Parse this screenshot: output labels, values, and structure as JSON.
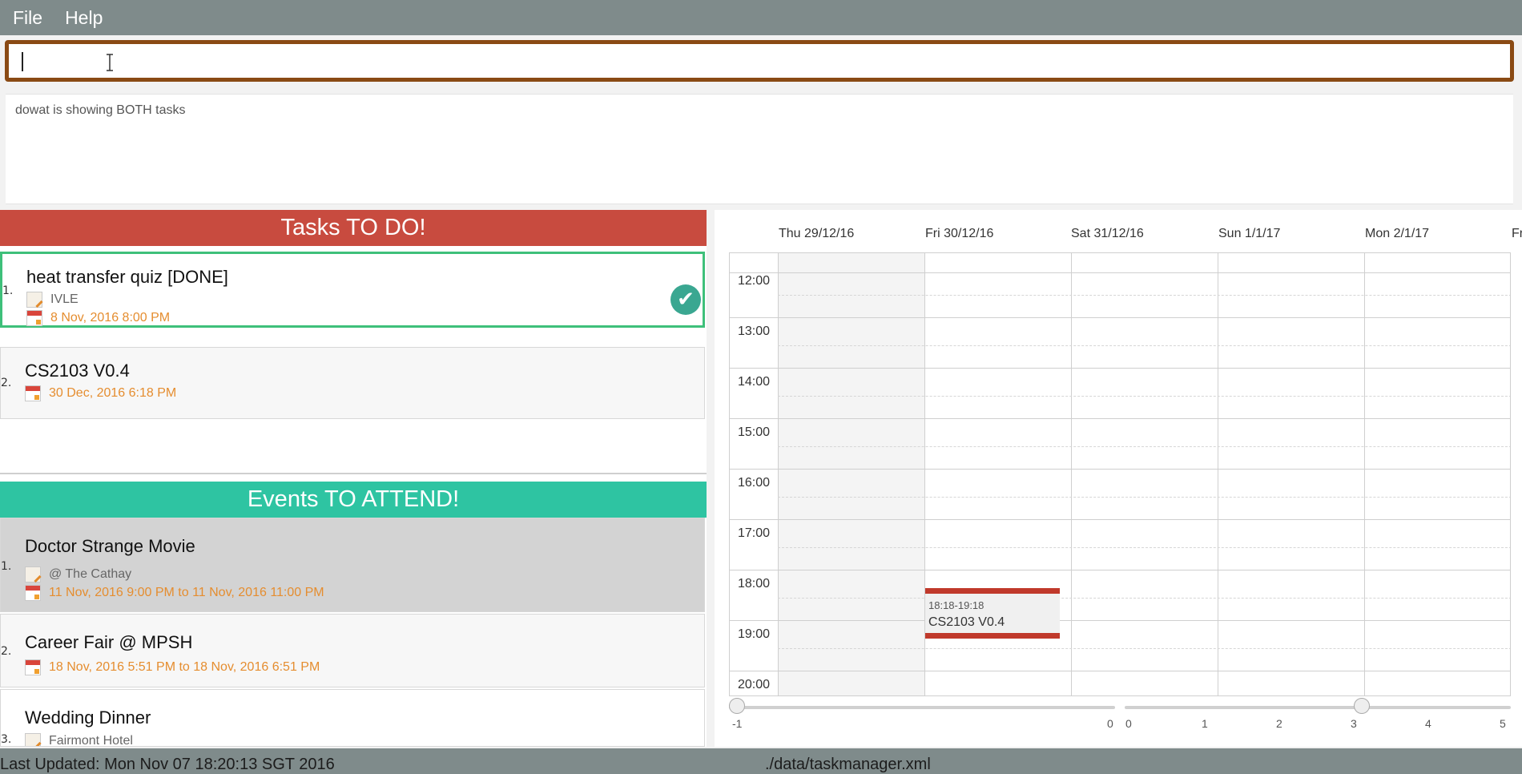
{
  "menu": {
    "file": "File",
    "help": "Help"
  },
  "command": {
    "value": "",
    "placeholder": ""
  },
  "result": {
    "text": "dowat is showing BOTH tasks"
  },
  "tasks": {
    "header": "Tasks TO DO!",
    "items": [
      {
        "index": "1.",
        "title": "heat transfer quiz [DONE]",
        "note": "IVLE",
        "date": "8 Nov, 2016 8:00 PM",
        "done": true
      },
      {
        "index": "2.",
        "title": "CS2103 V0.4",
        "date": "30 Dec, 2016 6:18 PM",
        "done": false
      }
    ]
  },
  "events": {
    "header": "Events TO ATTEND!",
    "items": [
      {
        "index": "1.",
        "title": "Doctor Strange Movie",
        "note": "@ The Cathay",
        "date": "11 Nov, 2016 9:00 PM to 11 Nov, 2016 11:00 PM"
      },
      {
        "index": "2.",
        "title": "Career Fair @ MPSH",
        "date": "18 Nov, 2016 5:51 PM to 18 Nov, 2016 6:51 PM"
      },
      {
        "index": "3.",
        "title": "Wedding Dinner",
        "note": "Fairmont Hotel"
      }
    ]
  },
  "calendar": {
    "days": [
      "Thu 29/12/16",
      "Fri 30/12/16",
      "Sat 31/12/16",
      "Sun 1/1/17",
      "Mon 2/1/17",
      "Fr"
    ],
    "times": [
      "12:00",
      "13:00",
      "14:00",
      "15:00",
      "16:00",
      "17:00",
      "18:00",
      "19:00",
      "20:00"
    ],
    "event": {
      "time": "18:18-19:18",
      "name": "CS2103 V0.4"
    },
    "slider_left_ticks": [
      "-1",
      "0"
    ],
    "slider_right_ticks": [
      "0",
      "1",
      "2",
      "3",
      "4",
      "5"
    ]
  },
  "footer": {
    "last_updated": "Last Updated: Mon Nov 07 18:20:13 SGT 2016",
    "file_path": "./data/taskmanager.xml"
  },
  "colors": {
    "menubar": "#7f8b8b",
    "tasks_header": "#c84b3f",
    "events_header": "#2ec4a2",
    "command_border": "#8a4a14",
    "date_text": "#e58d2f",
    "done_border": "#3ec07a"
  }
}
